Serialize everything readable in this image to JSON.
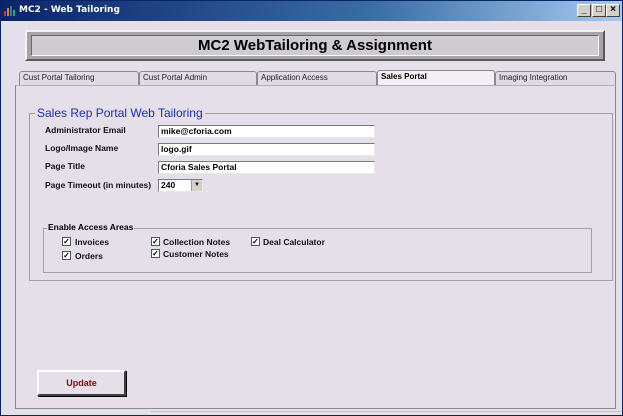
{
  "window": {
    "title": "MC2 - Web Tailoring",
    "controls": {
      "minimize": "_",
      "maximize": "□",
      "close": "×"
    }
  },
  "header": {
    "title": "MC2 WebTailoring & Assignment"
  },
  "tabs": [
    {
      "label": "Cust Portal Tailoring",
      "active": false
    },
    {
      "label": "Cust Portal Admin",
      "active": false
    },
    {
      "label": "Application Access",
      "active": false
    },
    {
      "label": "Sales Portal",
      "active": true
    },
    {
      "label": "Imaging Integration",
      "active": false
    }
  ],
  "form": {
    "group_title": "Sales Rep Portal Web Tailoring",
    "fields": {
      "admin_email": {
        "label": "Administrator Email",
        "value": "mike@cforia.com"
      },
      "logo": {
        "label": "Logo/Image Name",
        "value": "logo.gif"
      },
      "page_title": {
        "label": "Page Title",
        "value": "Cforia Sales Portal"
      },
      "timeout": {
        "label": "Page Timeout (in minutes)",
        "value": "240"
      }
    },
    "access": {
      "title": "Enable Access Areas",
      "items": {
        "invoices": {
          "label": "Invoices",
          "checked": true
        },
        "orders": {
          "label": "Orders",
          "checked": true
        },
        "collection_notes": {
          "label": "Collection Notes",
          "checked": true
        },
        "customer_notes": {
          "label": "Customer Notes",
          "checked": true
        },
        "deal_calculator": {
          "label": "Deal Calculator",
          "checked": true
        }
      },
      "check_mark": "✓"
    }
  },
  "buttons": {
    "update": "Update"
  },
  "colors": {
    "title_bar": "#0a246a",
    "group_title": "#1a2fb0",
    "update_text": "#7a1010",
    "background": "#e4dfe8"
  }
}
